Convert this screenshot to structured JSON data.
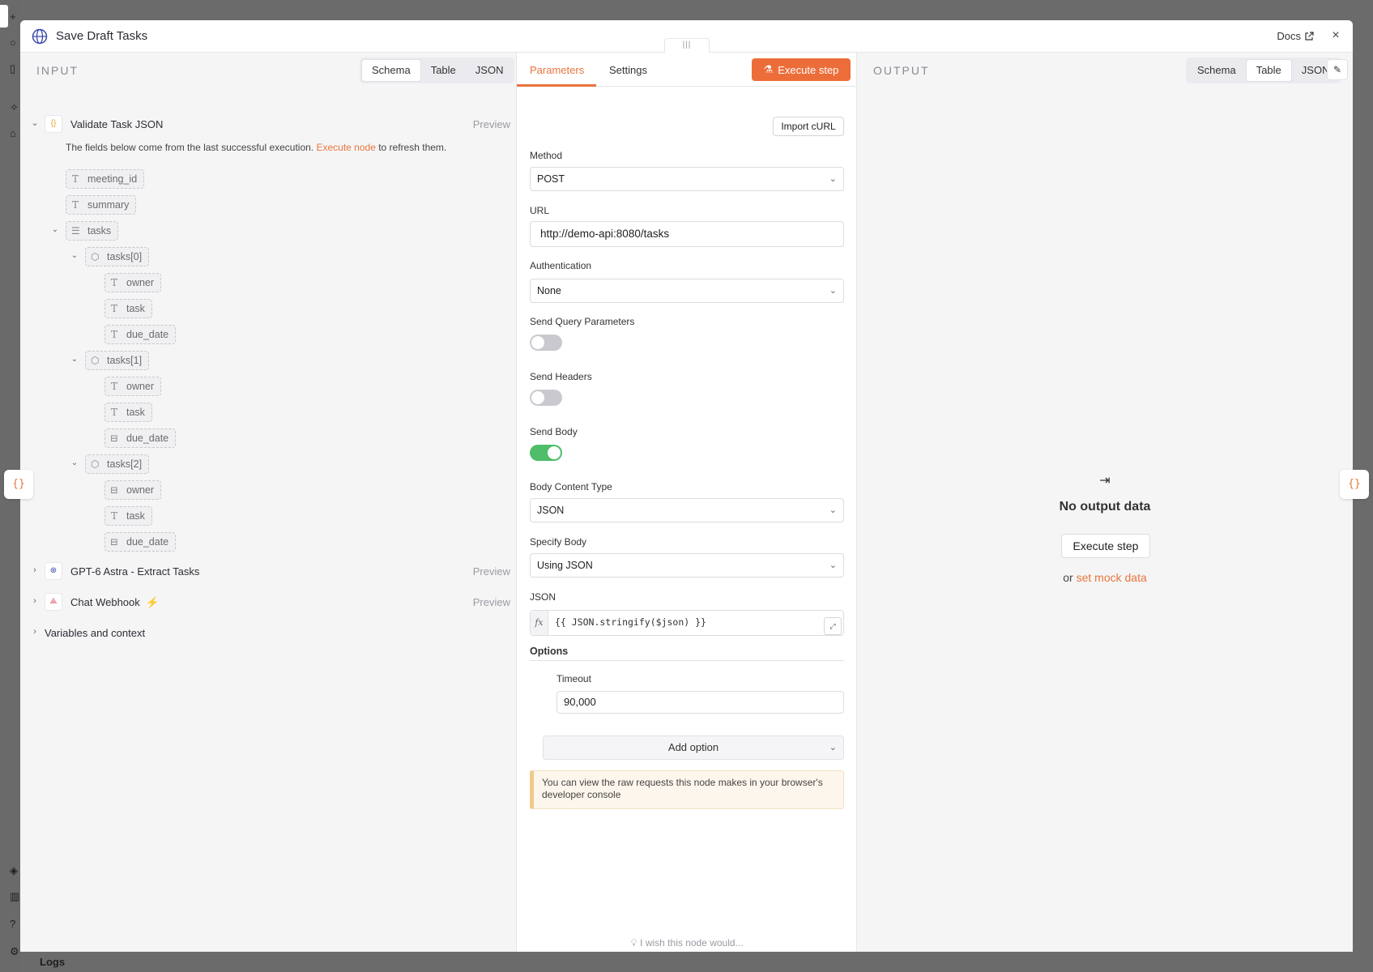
{
  "modal": {
    "title": "Save Draft Tasks",
    "docs_label": "Docs",
    "close_label": "×"
  },
  "input": {
    "label": "INPUT",
    "view_tabs": [
      "Schema",
      "Table",
      "JSON"
    ],
    "active_tab": "Schema",
    "info_prefix": "The fields below come from the last successful execution.",
    "info_link": "Execute node",
    "info_suffix": "to refresh them.",
    "nodes": [
      {
        "name": "Validate Task JSON",
        "preview": "Preview",
        "expanded": true
      },
      {
        "name": "GPT-6 Astra - Extract Tasks",
        "preview": "Preview",
        "expanded": false
      },
      {
        "name": "Chat Webhook",
        "preview": "Preview",
        "expanded": false
      }
    ],
    "variables_label": "Variables and context",
    "fields": {
      "meeting_id": "meeting_id",
      "summary": "summary",
      "tasks": "tasks",
      "tasks0": "tasks[0]",
      "tasks1": "tasks[1]",
      "tasks2": "tasks[2]",
      "owner": "owner",
      "task": "task",
      "due_date": "due_date"
    }
  },
  "params": {
    "tabs": [
      "Parameters",
      "Settings"
    ],
    "active_tab": "Parameters",
    "execute_label": "Execute step",
    "import_label": "Import cURL",
    "method_label": "Method",
    "method_value": "POST",
    "url_label": "URL",
    "url_value": "http://demo-api:8080/tasks",
    "auth_label": "Authentication",
    "auth_value": "None",
    "send_query_label": "Send Query Parameters",
    "send_query_on": false,
    "send_headers_label": "Send Headers",
    "send_headers_on": false,
    "send_body_label": "Send Body",
    "send_body_on": true,
    "body_type_label": "Body Content Type",
    "body_type_value": "JSON",
    "specify_body_label": "Specify Body",
    "specify_body_value": "Using JSON",
    "json_label": "JSON",
    "json_value": "{{ JSON.stringify($json) }}",
    "fx_label": "fx",
    "options_label": "Options",
    "timeout_label": "Timeout",
    "timeout_value": "90,000",
    "add_option_label": "Add option",
    "notice": "You can view the raw requests this node makes in your browser's developer console",
    "wish_label": "I wish this node would..."
  },
  "output": {
    "label": "OUTPUT",
    "view_tabs": [
      "Schema",
      "Table",
      "JSON"
    ],
    "active_tab": "Table",
    "empty_title": "No output data",
    "execute_label": "Execute step",
    "or_label": "or",
    "mock_link": "set mock data"
  },
  "footer": {
    "logs_label": "Logs"
  },
  "colors": {
    "accent": "#ed6d3a",
    "toggle_on": "#4fbd6a"
  }
}
